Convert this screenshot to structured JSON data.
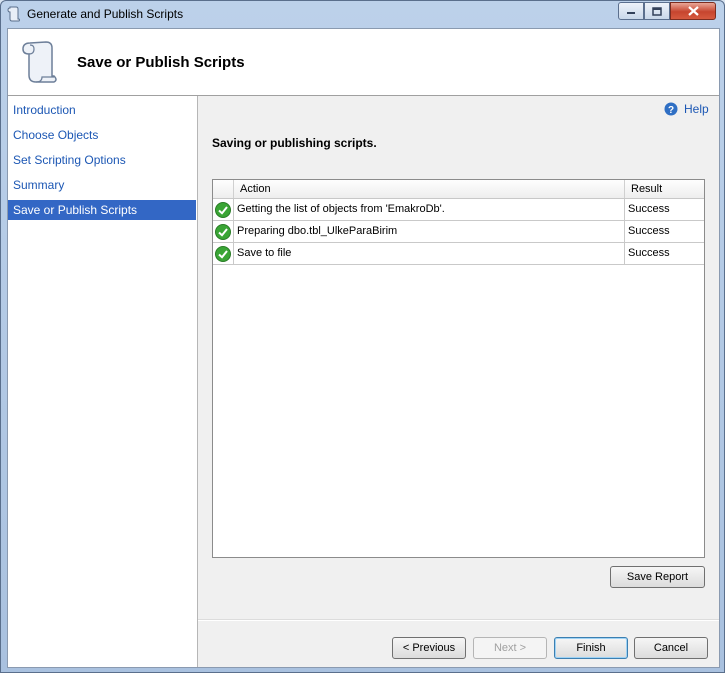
{
  "window": {
    "title": "Generate and Publish Scripts"
  },
  "header": {
    "title": "Save or Publish Scripts"
  },
  "nav": {
    "items": [
      {
        "label": "Introduction"
      },
      {
        "label": "Choose Objects"
      },
      {
        "label": "Set Scripting Options"
      },
      {
        "label": "Summary"
      },
      {
        "label": "Save or Publish Scripts",
        "selected": true
      }
    ]
  },
  "help": {
    "label": "Help"
  },
  "status": {
    "heading": "Saving or publishing scripts."
  },
  "grid": {
    "columns": [
      "Action",
      "Result"
    ],
    "rows": [
      {
        "action": "Getting the list of objects from 'EmakroDb'.",
        "result": "Success",
        "icon": "success-check-icon"
      },
      {
        "action": "Preparing dbo.tbl_UlkeParaBirim",
        "result": "Success",
        "icon": "success-check-icon"
      },
      {
        "action": "Save to file",
        "result": "Success",
        "icon": "success-check-icon"
      }
    ]
  },
  "buttons": {
    "save_report": "Save Report",
    "previous": "< Previous",
    "next": "Next >",
    "finish": "Finish",
    "cancel": "Cancel"
  },
  "colors": {
    "selected_nav": "#3367c5",
    "link": "#1c57b4",
    "success": "#3aa535"
  }
}
